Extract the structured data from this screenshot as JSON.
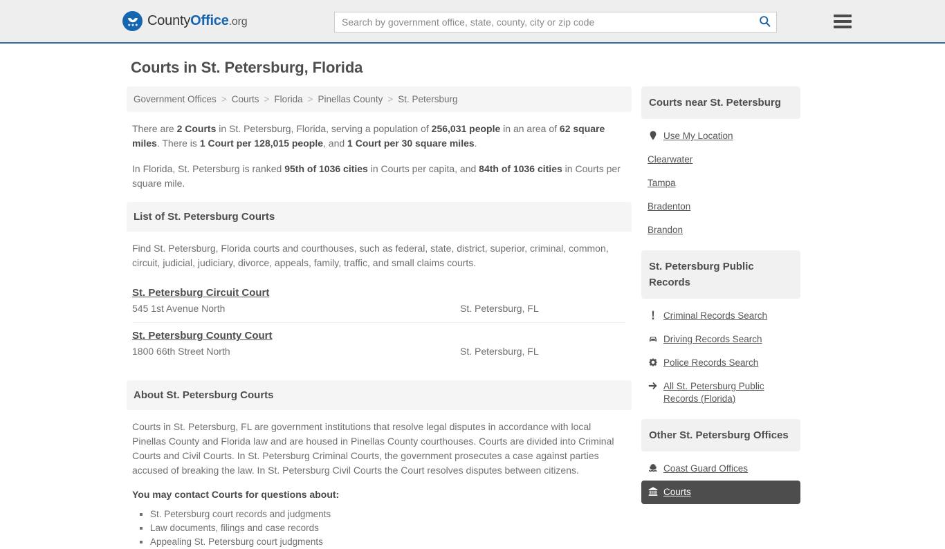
{
  "header": {
    "brand": {
      "part1": "County",
      "part2": "Office",
      "tld": ".org",
      "icon": "eagle-crest-icon"
    },
    "search": {
      "placeholder": "Search by government office, state, county, city or zip code",
      "value": "",
      "icon": "search-icon"
    },
    "menu_icon": "hamburger-menu-icon",
    "accent_color": "#1565b0",
    "border_color": "#2f6ca5",
    "background": "#eeeeee"
  },
  "page": {
    "title": "Courts in St. Petersburg, Florida"
  },
  "breadcrumb": {
    "separator": ">",
    "items": [
      {
        "label": "Government Offices"
      },
      {
        "label": "Courts"
      },
      {
        "label": "Florida"
      },
      {
        "label": "Pinellas County"
      },
      {
        "label": "St. Petersburg"
      }
    ]
  },
  "intro": {
    "paragraph1": [
      {
        "t": "There are ",
        "b": false
      },
      {
        "t": "2 Courts",
        "b": true
      },
      {
        "t": " in St. Petersburg, Florida, serving a population of ",
        "b": false
      },
      {
        "t": "256,031 people",
        "b": true
      },
      {
        "t": " in an area of ",
        "b": false
      },
      {
        "t": "62 square miles",
        "b": true
      },
      {
        "t": ". There is ",
        "b": false
      },
      {
        "t": "1 Court per 128,015 people",
        "b": true
      },
      {
        "t": ", and ",
        "b": false
      },
      {
        "t": "1 Court per 30 square miles",
        "b": true
      },
      {
        "t": ".",
        "b": false
      }
    ],
    "paragraph2": [
      {
        "t": "In Florida, St. Petersburg is ranked ",
        "b": false
      },
      {
        "t": "95th of 1036 cities",
        "b": true
      },
      {
        "t": " in Courts per capita, and ",
        "b": false
      },
      {
        "t": "84th of 1036 cities",
        "b": true
      },
      {
        "t": " in Courts per square mile.",
        "b": false
      }
    ]
  },
  "list_section": {
    "heading": "List of St. Petersburg Courts",
    "description": "Find St. Petersburg, Florida courts and courthouses, such as federal, state, district, superior, criminal, common, circuit, judicial, judiciary, divorce, appeals, family, traffic, and small claims courts.",
    "courts": [
      {
        "name": "St. Petersburg Circuit Court",
        "address": "545 1st Avenue North",
        "city": "St. Petersburg, FL"
      },
      {
        "name": "St. Petersburg County Court",
        "address": "1800 66th Street North",
        "city": "St. Petersburg, FL"
      }
    ]
  },
  "about_section": {
    "heading": "About St. Petersburg Courts",
    "body": "Courts in St. Petersburg, FL are government institutions that resolve legal disputes in accordance with local Pinellas County and Florida law and are housed in Pinellas County courthouses. Courts are divided into Criminal Courts and Civil Courts. In St. Petersburg Criminal Courts, the government prosecutes a case against parties accused of breaking the law. In St. Petersburg Civil Courts the Court resolves disputes between citizens.",
    "contact_lead": "You may contact Courts for questions about:",
    "bullets": [
      "St. Petersburg court records and judgments",
      "Law documents, filings and case records",
      "Appealing St. Petersburg court judgments"
    ]
  },
  "sidebar": {
    "nearby": {
      "heading": "Courts near St. Petersburg",
      "items": [
        {
          "label": "Use My Location",
          "icon": "map-pin-icon"
        },
        {
          "label": "Clearwater",
          "icon": ""
        },
        {
          "label": "Tampa",
          "icon": ""
        },
        {
          "label": "Bradenton",
          "icon": ""
        },
        {
          "label": "Brandon",
          "icon": ""
        }
      ]
    },
    "public_records": {
      "heading": "St. Petersburg Public Records",
      "items": [
        {
          "label": "Criminal Records Search",
          "icon": "exclamation-icon"
        },
        {
          "label": "Driving Records Search",
          "icon": "car-icon"
        },
        {
          "label": "Police Records Search",
          "icon": "police-badge-icon"
        },
        {
          "label": "All St. Petersburg Public Records (Florida)",
          "icon": "arrow-right-icon"
        }
      ]
    },
    "other_offices": {
      "heading": "Other St. Petersburg Offices",
      "items": [
        {
          "label": "Coast Guard Offices",
          "icon": "ship-icon",
          "active": false
        },
        {
          "label": "Courts",
          "icon": "courthouse-icon",
          "active": true
        }
      ]
    },
    "active_background": "#4d4d4d"
  }
}
